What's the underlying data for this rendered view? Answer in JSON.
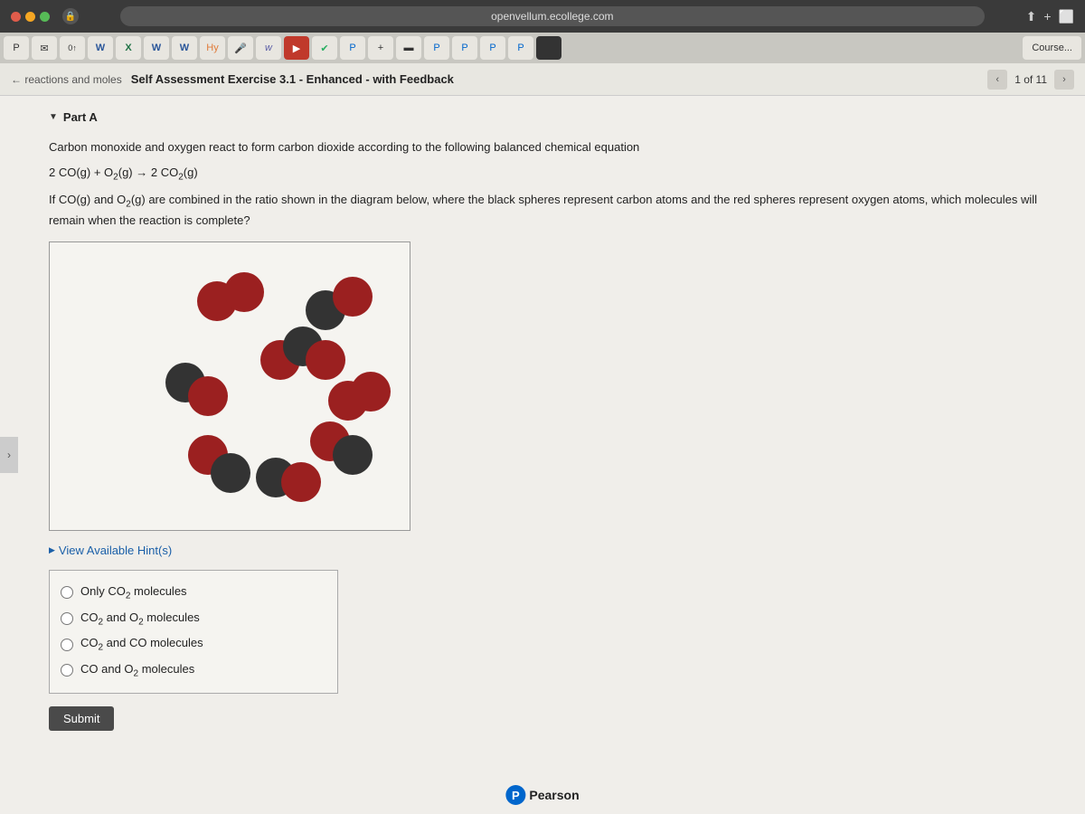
{
  "browser": {
    "url": "openvellum.ecollege.com",
    "plus_icon": "+",
    "course_tab": "Course..."
  },
  "nav": {
    "title": "Self Assessment Exercise 3.1 - Enhanced - with Feedback",
    "page_current": "1",
    "page_total": "11",
    "page_label": "1 of 11"
  },
  "part": {
    "label": "Part A"
  },
  "question": {
    "intro": "Carbon monoxide and oxygen react to form carbon dioxide according to the following balanced chemical equation",
    "equation": "2 CO(g) + O₂(g) → 2 CO₂(g)",
    "condition": "If CO(g) and O₂(g) are combined in the ratio shown in the diagram below, where the black spheres represent carbon atoms and the red spheres represent oxygen atoms, which molecules will remain when the reaction is complete?"
  },
  "hint": {
    "label": "View Available Hint(s)"
  },
  "choices": [
    {
      "id": "choice-1",
      "text": "Only CO₂ molecules",
      "raw": "Only CO"
    },
    {
      "id": "choice-2",
      "text": "CO₂ and O₂ molecules",
      "raw": "CO₂ and O₂ molecules"
    },
    {
      "id": "choice-3",
      "text": "CO₂ and CO molecules",
      "raw": "CO₂ and CO molecules"
    },
    {
      "id": "choice-4",
      "text": "CO and O₂ molecules",
      "raw": "CO and O₂ molecules"
    }
  ],
  "submit": {
    "label": "Submit"
  },
  "pearson": {
    "label": "Pearson"
  }
}
